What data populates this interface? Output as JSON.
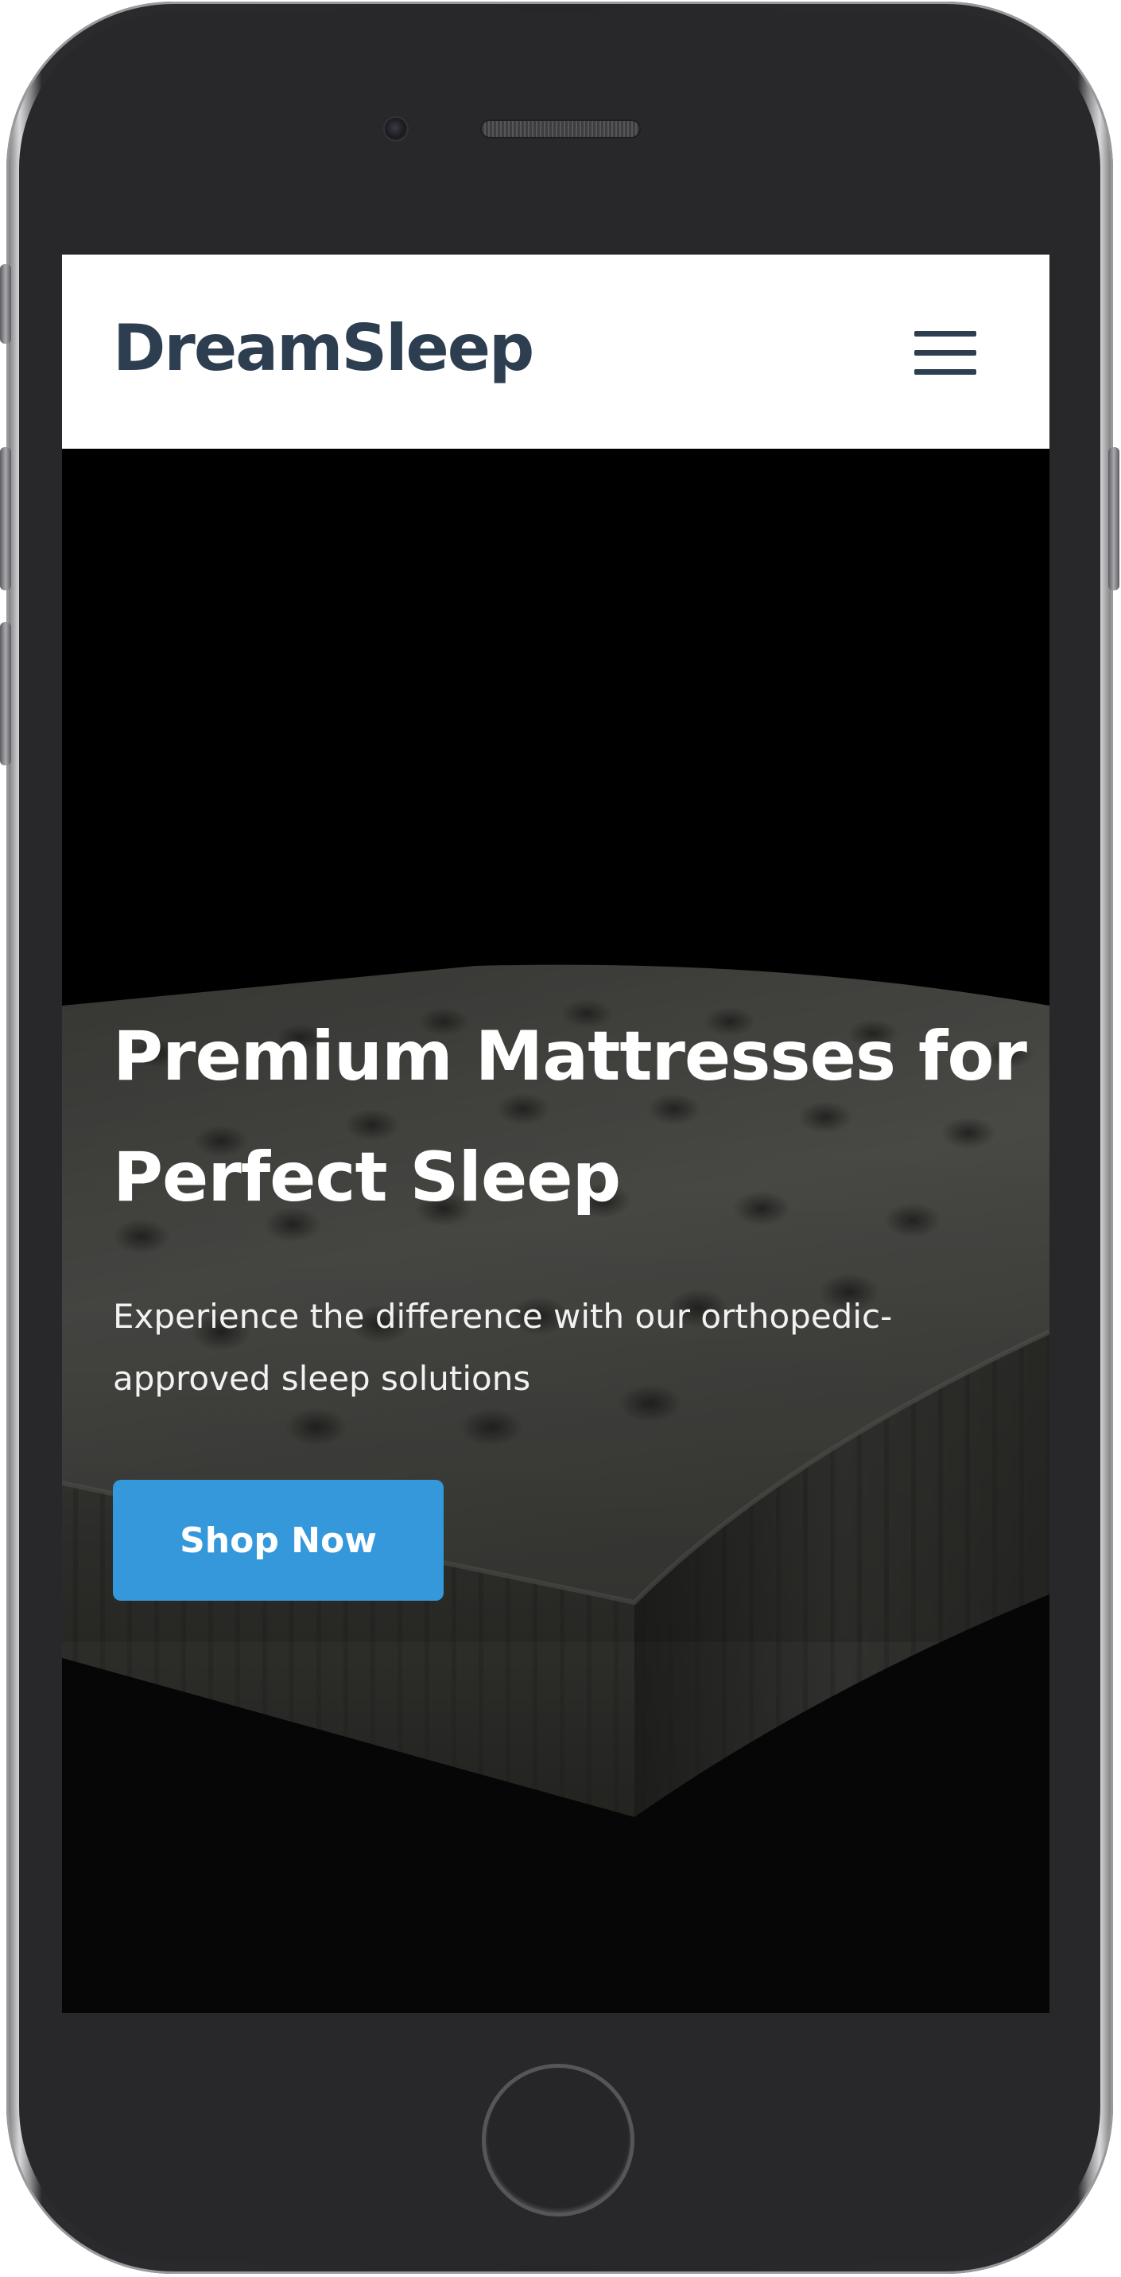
{
  "app": {
    "brand": "DreamSleep",
    "menu_icon": "hamburger-menu-icon"
  },
  "hero": {
    "title": "Premium Mattresses for Perfect Sleep",
    "subtitle": "Experience the difference with our orthopedic-approved sleep solutions",
    "cta_label": "Shop Now",
    "background_image": "mattress-photo"
  },
  "colors": {
    "brand_text": "#2c3e50",
    "cta_background": "#3498db",
    "navbar_background": "#ffffff",
    "hero_text": "#ffffff",
    "device_frame": "#28282b"
  }
}
